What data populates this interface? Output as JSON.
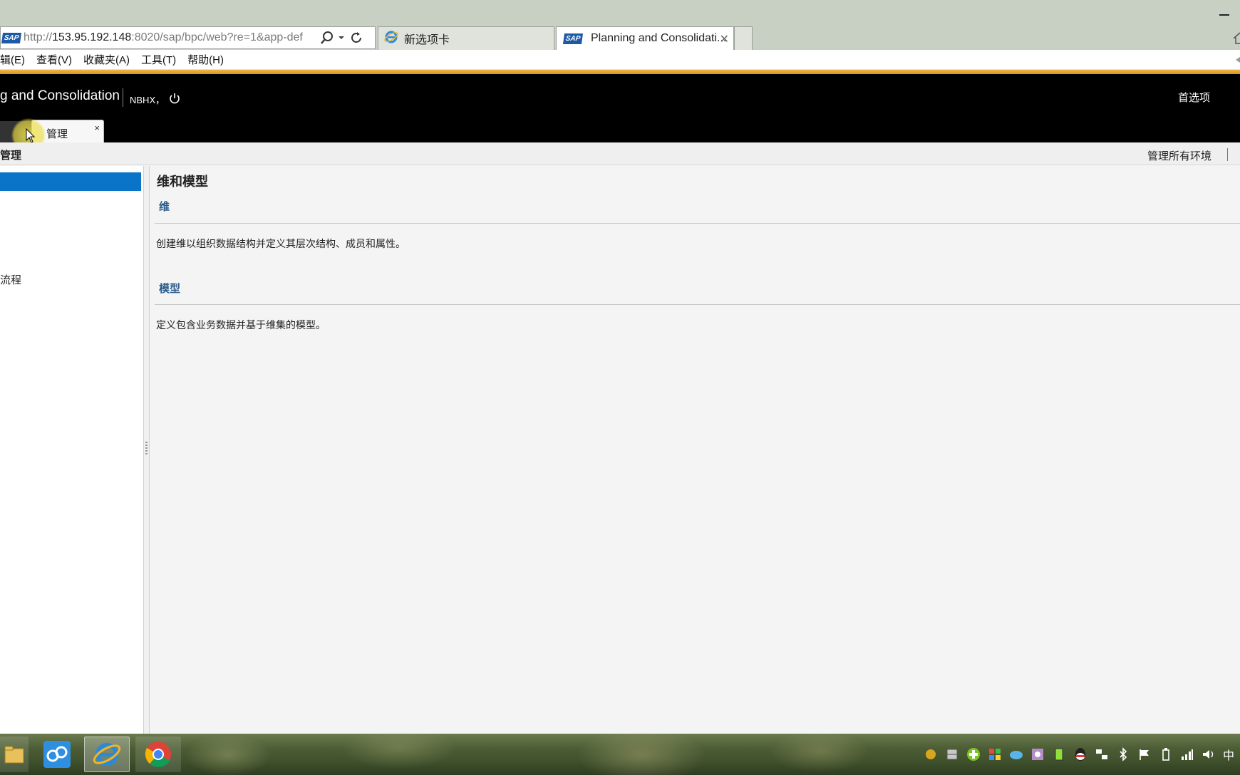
{
  "browser": {
    "address": {
      "url_prefix": "http://",
      "url_host": "153.95.192.148",
      "url_rest": ":8020/sap/bpc/web?re=1&app-def"
    },
    "tabs": [
      {
        "label": "新选项卡"
      },
      {
        "label": "Planning and Consolidati..."
      }
    ],
    "tab_close": "✕",
    "menu": [
      "辑(E)",
      "查看(V)",
      "收藏夹(A)",
      "工具(T)",
      "帮助(H)"
    ]
  },
  "app": {
    "sap_logo": "SAP",
    "title": "g and Consolidation",
    "user": "NBHX，",
    "preferences": "首选项",
    "tab_manage": "管理",
    "tab_close": "×"
  },
  "subheader": {
    "title": "管理",
    "manage_env": "管理所有环境"
  },
  "nav": {
    "process_label": "流程"
  },
  "main": {
    "title": "维和模型",
    "dimensions": {
      "heading": "维",
      "description": "创建维以组织数据结构并定义其层次结构、成员和属性。"
    },
    "models": {
      "heading": "模型",
      "description": "定义包含业务数据并基于维集的模型。"
    }
  },
  "taskbar": {
    "ime": "中"
  }
}
